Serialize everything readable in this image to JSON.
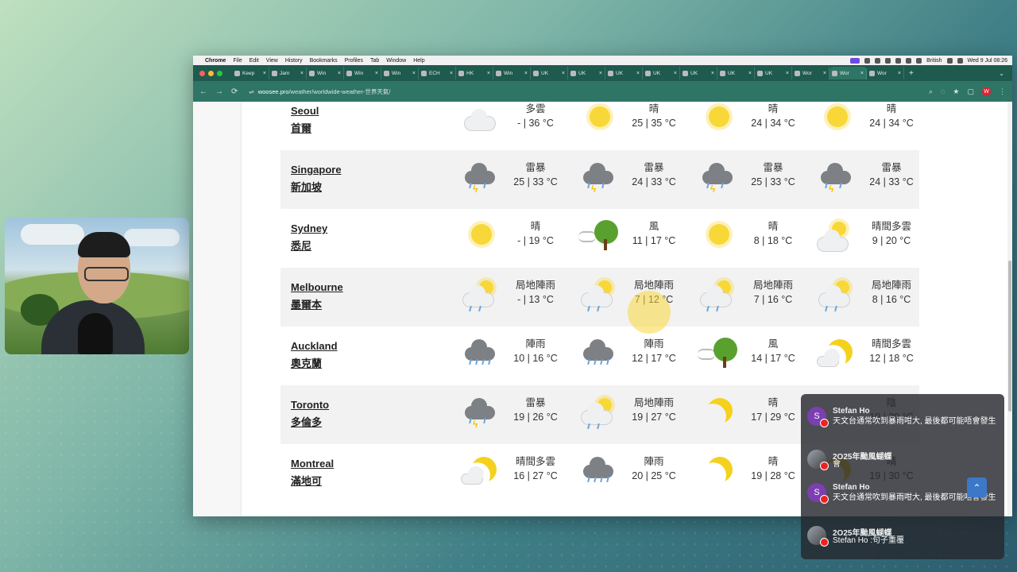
{
  "menubar": {
    "app": "Chrome",
    "items": [
      "File",
      "Edit",
      "View",
      "History",
      "Bookmarks",
      "Profiles",
      "Tab",
      "Window",
      "Help"
    ],
    "input_source": "British",
    "clock": "Wed 9 Jul 08:26"
  },
  "tabs": [
    {
      "label": "Keep"
    },
    {
      "label": "Jam"
    },
    {
      "label": "Win"
    },
    {
      "label": "Win"
    },
    {
      "label": "Win"
    },
    {
      "label": "ECH"
    },
    {
      "label": "HK"
    },
    {
      "label": "Win"
    },
    {
      "label": "UK"
    },
    {
      "label": "UK"
    },
    {
      "label": "UK"
    },
    {
      "label": "UK"
    },
    {
      "label": "UK"
    },
    {
      "label": "UK"
    },
    {
      "label": "UK"
    },
    {
      "label": "Wor"
    },
    {
      "label": "Wor",
      "active": true
    },
    {
      "label": "Wor"
    }
  ],
  "address": {
    "host": "woosee.pro",
    "path": "/weather/worldwide-weather-世界天氣/"
  },
  "rows": [
    {
      "en": "Seoul",
      "zh": "首爾",
      "days": [
        {
          "icon": "cloudy-icon",
          "cond": "多雲",
          "temp": "- | 36 °C"
        },
        {
          "icon": "sunny-icon",
          "cond": "晴",
          "temp": "25 | 35 °C"
        },
        {
          "icon": "sunny-icon",
          "cond": "晴",
          "temp": "24 | 34 °C"
        },
        {
          "icon": "sunny-icon",
          "cond": "晴",
          "temp": "24 | 34 °C"
        }
      ]
    },
    {
      "en": "Singapore",
      "zh": "新加坡",
      "days": [
        {
          "icon": "thunderstorm-icon",
          "cond": "雷暴",
          "temp": "25 | 33 °C"
        },
        {
          "icon": "thunderstorm-icon",
          "cond": "雷暴",
          "temp": "24 | 33 °C"
        },
        {
          "icon": "thunderstorm-icon",
          "cond": "雷暴",
          "temp": "25 | 33 °C"
        },
        {
          "icon": "thunderstorm-icon",
          "cond": "雷暴",
          "temp": "24 | 33 °C"
        }
      ]
    },
    {
      "en": "Sydney",
      "zh": "悉尼",
      "days": [
        {
          "icon": "sunny-icon",
          "cond": "晴",
          "temp": "- | 19 °C"
        },
        {
          "icon": "windy-icon",
          "cond": "風",
          "temp": "11 | 17 °C"
        },
        {
          "icon": "sunny-icon",
          "cond": "晴",
          "temp": "8 | 18 °C"
        },
        {
          "icon": "partly-cloudy-icon",
          "cond": "晴間多雲",
          "temp": "9 | 20 °C"
        }
      ]
    },
    {
      "en": "Melbourne",
      "zh": "墨爾本",
      "days": [
        {
          "icon": "showers-icon",
          "cond": "局地陣雨",
          "temp": "- | 13 °C"
        },
        {
          "icon": "showers-icon",
          "cond": "局地陣雨",
          "temp": "7 | 12 °C"
        },
        {
          "icon": "showers-icon",
          "cond": "局地陣雨",
          "temp": "7 | 16 °C"
        },
        {
          "icon": "showers-icon",
          "cond": "局地陣雨",
          "temp": "8 | 16 °C"
        }
      ]
    },
    {
      "en": "Auckland",
      "zh": "奧克蘭",
      "days": [
        {
          "icon": "rain-icon",
          "cond": "陣雨",
          "temp": "10 | 16 °C"
        },
        {
          "icon": "rain-icon",
          "cond": "陣雨",
          "temp": "12 | 17 °C"
        },
        {
          "icon": "windy-icon",
          "cond": "風",
          "temp": "14 | 17 °C"
        },
        {
          "icon": "moon-cloud-icon",
          "cond": "晴間多雲",
          "temp": "12 | 18 °C"
        }
      ]
    },
    {
      "en": "Toronto",
      "zh": "多倫多",
      "days": [
        {
          "icon": "thunderstorm-icon",
          "cond": "雷暴",
          "temp": "19 | 26 °C"
        },
        {
          "icon": "showers-icon",
          "cond": "局地陣雨",
          "temp": "19 | 27 °C"
        },
        {
          "icon": "moon-icon",
          "cond": "晴",
          "temp": "17 | 29 °C"
        },
        {
          "icon": "cloudy-icon",
          "cond": "陰",
          "temp": "19 | 29 °C"
        }
      ]
    },
    {
      "en": "Montreal",
      "zh": "滿地可",
      "days": [
        {
          "icon": "moon-cloud-icon",
          "cond": "晴間多雲",
          "temp": "16 | 27 °C"
        },
        {
          "icon": "rain-icon",
          "cond": "陣雨",
          "temp": "20 | 25 °C"
        },
        {
          "icon": "moon-icon",
          "cond": "晴",
          "temp": "19 | 28 °C"
        },
        {
          "icon": "moon-icon",
          "cond": "晴",
          "temp": "19 | 30 °C"
        }
      ]
    }
  ],
  "chat": [
    {
      "avatar": "S",
      "author": "Stefan Ho",
      "text": "天文台通常吹到暴雨咁大, 最後都可能唔會發生"
    },
    {
      "avatar": "",
      "author": "2O25年颱風蝴蝶",
      "text": "會"
    },
    {
      "avatar": "S",
      "author": "Stefan Ho",
      "text": "天文台通常吹到暴雨咁大, 最後都可能唔會發生"
    },
    {
      "avatar": "",
      "author": "2O25年颱風蝴蝶",
      "text": "Stefan Ho :句子重覆"
    }
  ],
  "colors": {
    "tab_bg": "#1f5a4f",
    "toolbar_bg": "#2f7566",
    "row_shade": "#f2f2f2",
    "back_to_top": "#3c78c8"
  }
}
